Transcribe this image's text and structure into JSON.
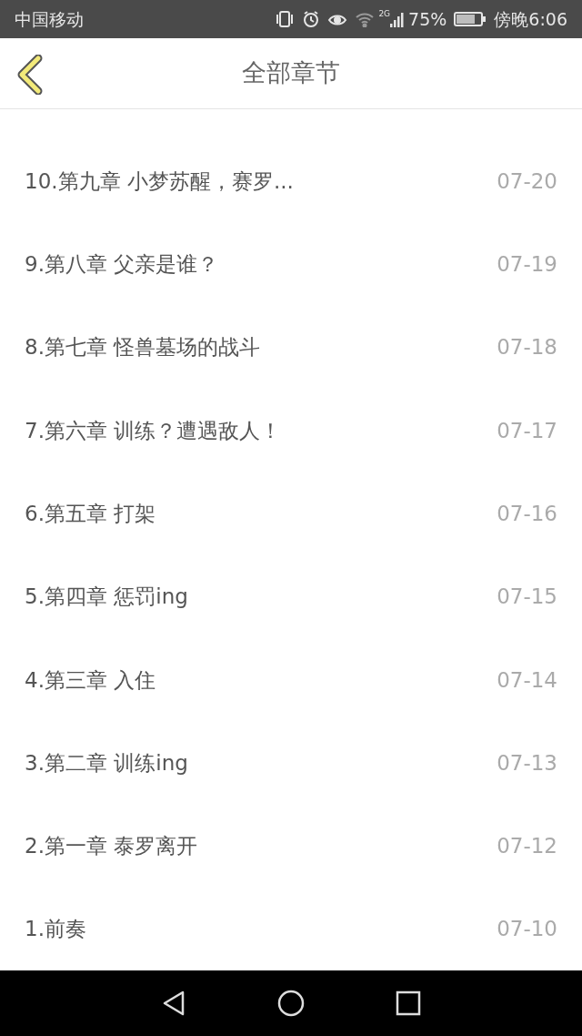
{
  "status_bar": {
    "carrier": "中国移动",
    "network": "2G",
    "battery": "75%",
    "time": "傍晚6:06"
  },
  "header": {
    "title": "全部章节"
  },
  "chapters": [
    {
      "title": "10.第九章 小梦苏醒，赛罗...",
      "date": "07-20"
    },
    {
      "title": "9.第八章 父亲是谁？",
      "date": "07-19"
    },
    {
      "title": "8.第七章 怪兽墓场的战斗",
      "date": "07-18"
    },
    {
      "title": "7.第六章 训练？遭遇敌人！",
      "date": "07-17"
    },
    {
      "title": "6.第五章 打架",
      "date": "07-16"
    },
    {
      "title": "5.第四章 惩罚ing",
      "date": "07-15"
    },
    {
      "title": "4.第三章 入住",
      "date": "07-14"
    },
    {
      "title": "3.第二章 训练ing",
      "date": "07-13"
    },
    {
      "title": "2.第一章 泰罗离开",
      "date": "07-12"
    },
    {
      "title": "1.前奏",
      "date": "07-10"
    }
  ]
}
